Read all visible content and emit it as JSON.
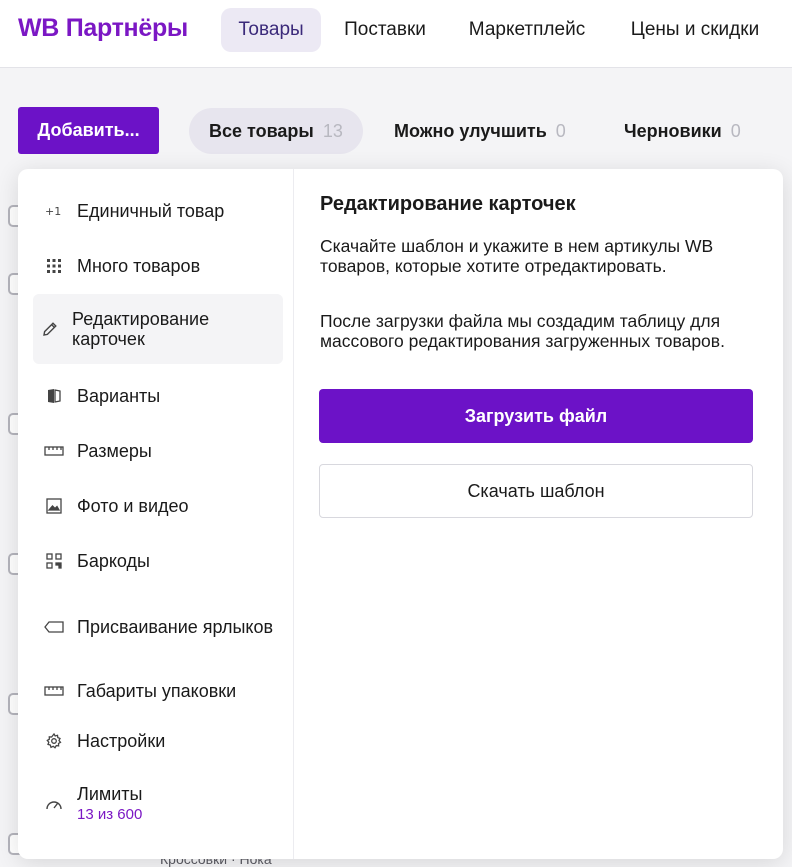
{
  "app": {
    "logo": "WB Партнёры"
  },
  "nav": {
    "items": [
      {
        "label": "Товары",
        "active": true
      },
      {
        "label": "Поставки"
      },
      {
        "label": "Маркетплейс"
      },
      {
        "label": "Цены и скидки"
      }
    ]
  },
  "toolbar": {
    "add_label": "Добавить...",
    "filters": [
      {
        "label": "Все товары",
        "count": "13",
        "active": true
      },
      {
        "label": "Можно улучшить",
        "count": "0"
      },
      {
        "label": "Черновики",
        "count": "0"
      }
    ]
  },
  "background": {
    "caption": "Кроссовки · Нока"
  },
  "menu": {
    "items": [
      {
        "label": "Единичный товар",
        "icon": "plus-one-icon"
      },
      {
        "label": "Много товаров",
        "icon": "grid-icon"
      },
      {
        "label": "Редактирование карточек",
        "icon": "pencil-icon",
        "active": true
      },
      {
        "label": "Варианты",
        "icon": "variants-icon"
      },
      {
        "label": "Размеры",
        "icon": "ruler-icon"
      },
      {
        "label": "Фото и видео",
        "icon": "image-icon"
      },
      {
        "label": "Баркоды",
        "icon": "qr-code-icon"
      },
      {
        "label": "Присваивание ярлыков",
        "icon": "tag-icon"
      },
      {
        "label": "Габариты упаковки",
        "icon": "ruler-icon"
      },
      {
        "label": "Настройки",
        "icon": "gear-icon"
      },
      {
        "label": "Лимиты",
        "sub": "13 из 600",
        "icon": "gauge-icon"
      }
    ]
  },
  "detail": {
    "title": "Редактирование карточек",
    "text1": "Скачайте шаблон и укажите в нем артикулы WB товаров, которые хотите отредактировать.",
    "text2": "После загрузки файла мы создадим таблицу для массового редактирования загруженных товаров.",
    "upload_label": "Загрузить файл",
    "download_label": "Скачать шаблон"
  },
  "colors": {
    "brand": "#7b17c4",
    "primary_button": "#6c12c7",
    "active_nav_bg": "#ece9f4"
  }
}
